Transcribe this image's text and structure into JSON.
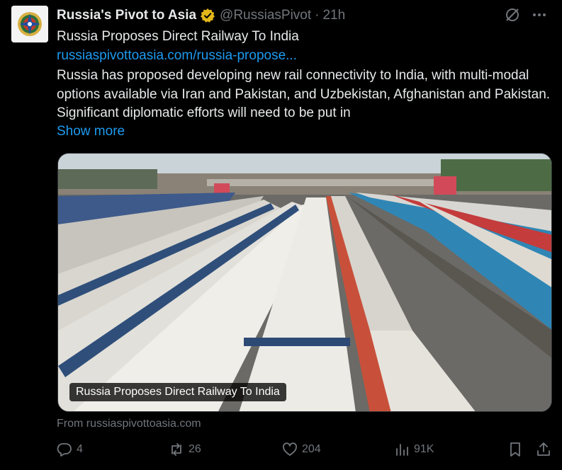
{
  "post": {
    "author": "Russia's Pivot to Asia",
    "handle": "@RussiasPivot",
    "separator": "·",
    "time": "21h",
    "title": "Russia Proposes Direct Railway To India",
    "link": "russiaspivottoasia.com/russia-propose...",
    "body": "Russia has proposed developing new rail connectivity to India, with multi-modal options available via Iran and Pakistan, and Uzbekistan, Afghanistan and Pakistan. Significant diplomatic efforts will need to be put in",
    "show_more": "Show more"
  },
  "card": {
    "caption": "Russia Proposes Direct Railway To India",
    "from": "From russiaspivottoasia.com"
  },
  "actions": {
    "replies": "4",
    "reposts": "26",
    "likes": "204",
    "views": "91K"
  },
  "icons": {
    "verified": "gold-verified-badge-icon",
    "grok": "grok-icon",
    "more": "more-horizontal-icon",
    "reply": "reply-icon",
    "repost": "repost-icon",
    "like": "heart-icon",
    "views": "views-chart-icon",
    "bookmark": "bookmark-icon",
    "share": "share-icon"
  },
  "colors": {
    "background": "#000000",
    "link": "#1d9bf0",
    "muted": "#71767b",
    "text": "#e7e9ea",
    "verified": "#e2b719"
  }
}
